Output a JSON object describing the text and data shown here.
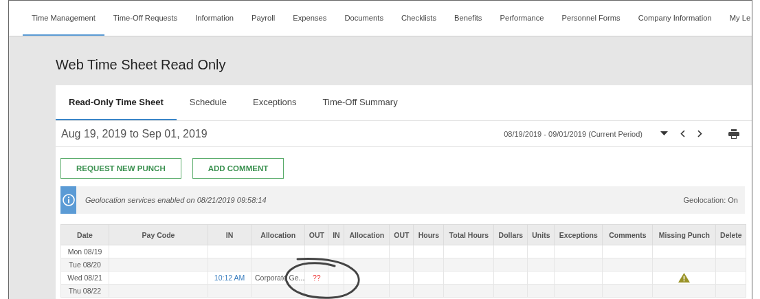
{
  "nav": [
    {
      "label": "Time Management",
      "selected": true
    },
    {
      "label": "Time-Off Requests",
      "selected": false
    },
    {
      "label": "Information",
      "selected": false
    },
    {
      "label": "Payroll",
      "selected": false
    },
    {
      "label": "Expenses",
      "selected": false
    },
    {
      "label": "Documents",
      "selected": false
    },
    {
      "label": "Checklists",
      "selected": false
    },
    {
      "label": "Benefits",
      "selected": false
    },
    {
      "label": "Performance",
      "selected": false
    },
    {
      "label": "Personnel Forms",
      "selected": false
    },
    {
      "label": "Company Information",
      "selected": false
    },
    {
      "label": "My Le",
      "selected": false
    }
  ],
  "page_title": "Web Time Sheet Read Only",
  "tabs": [
    {
      "label": "Read-Only Time Sheet",
      "selected": true
    },
    {
      "label": "Schedule",
      "selected": false
    },
    {
      "label": "Exceptions",
      "selected": false
    },
    {
      "label": "Time-Off Summary",
      "selected": false
    }
  ],
  "date_range": "Aug 19, 2019 to Sep 01, 2019",
  "period": "08/19/2019 - 09/01/2019 (Current Period)",
  "buttons": [
    "REQUEST NEW PUNCH",
    "ADD COMMENT"
  ],
  "info": {
    "message": "Geolocation services enabled on 08/21/2019 09:58:14",
    "status": "Geolocation: On"
  },
  "table": {
    "columns": [
      "Date",
      "Pay Code",
      "IN",
      "Allocation",
      "OUT",
      "IN",
      "Allocation",
      "OUT",
      "Hours",
      "Total Hours",
      "Dollars",
      "Units",
      "Exceptions",
      "Comments",
      "Missing Punch",
      "Delete"
    ],
    "rows": [
      {
        "date": "Mon 08/19",
        "missing_punch": false
      },
      {
        "date": "Tue 08/20",
        "missing_punch": false
      },
      {
        "date": "Wed 08/21",
        "in": "10:12 AM",
        "allocation": "Corporate Ge...",
        "out": "??",
        "missing_punch": true
      },
      {
        "date": "Thu 08/22",
        "missing_punch": false
      }
    ]
  }
}
